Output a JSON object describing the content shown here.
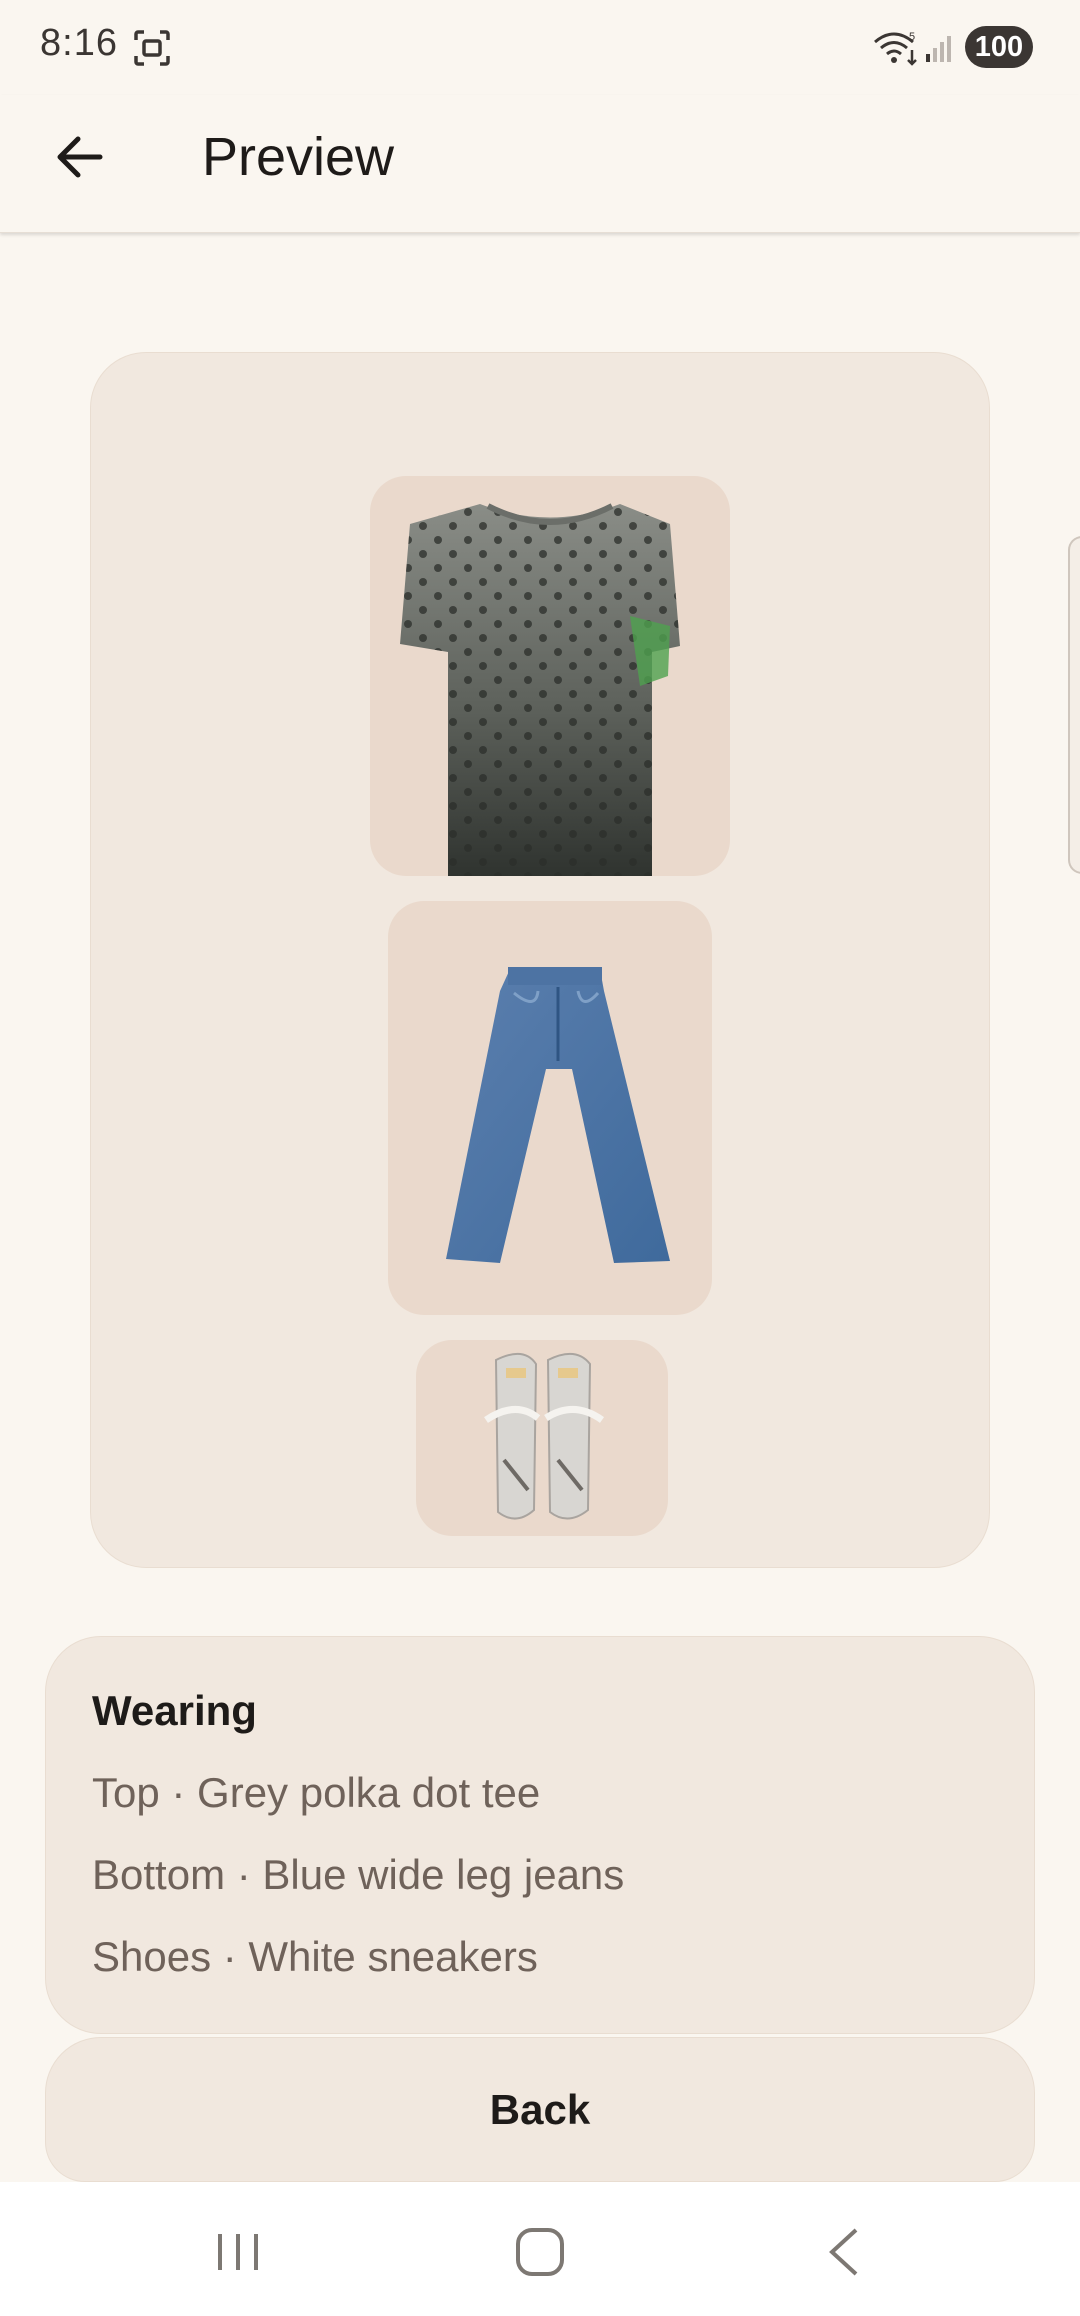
{
  "status_bar": {
    "time": "8:16",
    "battery": "100",
    "icons": [
      "screenshot-icon",
      "wifi-icon",
      "signal-icon"
    ]
  },
  "app_bar": {
    "title": "Preview",
    "back_icon": "arrow-left-icon"
  },
  "outfit": {
    "items": [
      {
        "slot": "top",
        "image": "grey-polka-dot-tee-image"
      },
      {
        "slot": "bottom",
        "image": "blue-wide-leg-jeans-image"
      },
      {
        "slot": "shoes",
        "image": "white-sneakers-image"
      }
    ]
  },
  "wearing": {
    "heading": "Wearing",
    "lines": [
      "Top · Grey polka dot tee",
      "Bottom · Blue wide leg jeans",
      "Shoes · White sneakers"
    ]
  },
  "actions": {
    "back_label": "Back"
  },
  "colors": {
    "background": "#faf6f0",
    "card": "#f1e8df",
    "tile": "#ead9cc",
    "muted_text": "#6f625a",
    "primary_text": "#1e1b19"
  },
  "nav_bar": {
    "icons": [
      "recents-icon",
      "home-icon",
      "back-chevron-icon"
    ]
  }
}
